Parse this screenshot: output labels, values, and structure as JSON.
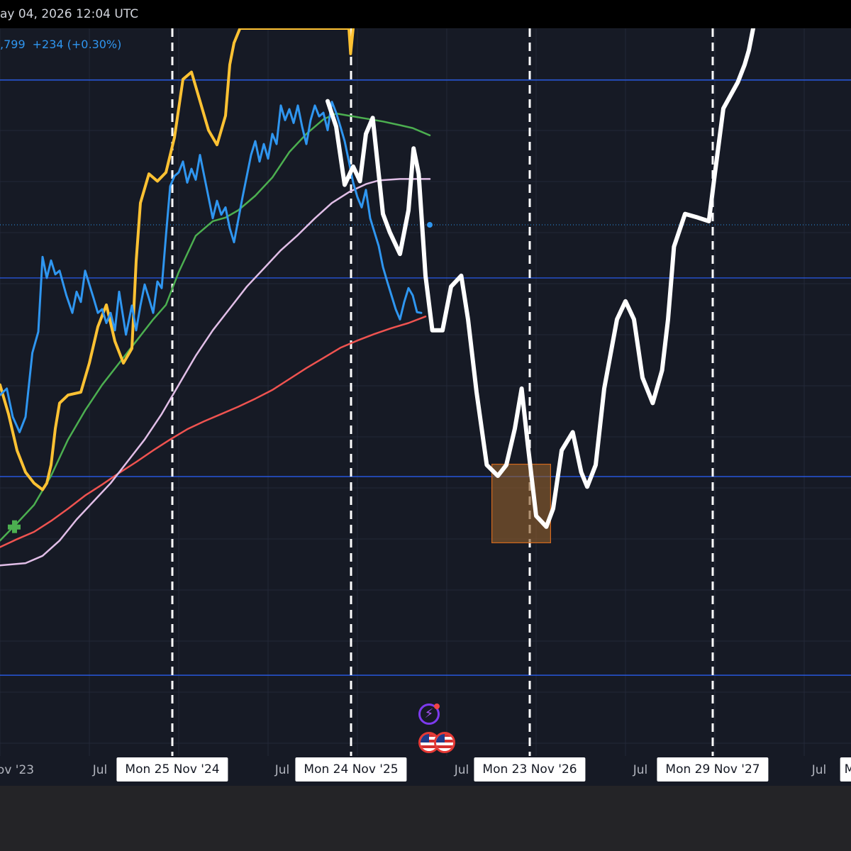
{
  "header": {
    "datetime": "ay 04, 2026 12:04 UTC",
    "price_fragment": ",799",
    "change": "+234 (+0.30%)"
  },
  "colors": {
    "background": "#161a25",
    "price_blue": "#2f96f0",
    "yellow": "#ffc233",
    "green": "#4caf50",
    "pink": "#e1bee7",
    "red": "#ef5350",
    "projection": "#ffffff",
    "box": "#8b5a2b",
    "hline": "#2962ff"
  },
  "axis": {
    "ticks": [
      "ov '23",
      "Jul",
      "Jul",
      "Jul",
      "Jul",
      "Jul",
      "M"
    ],
    "cycle_labels": [
      "Mon 25 Nov '24",
      "Mon 24 Nov '25",
      "Mon 23 Nov '26",
      "Mon 29 Nov '27"
    ]
  },
  "icons": [
    "flag-icon",
    "flag-icon",
    "spark-icon"
  ],
  "chart_data": {
    "type": "line",
    "x_range": [
      0,
      100
    ],
    "y_range": [
      0,
      100
    ],
    "grid": true,
    "horizontal_levels": [
      92.9,
      65.7,
      38.4,
      11.1
    ],
    "current_price_level": 73.0,
    "cycle_markers_x": [
      20.25,
      41.25,
      62.25,
      83.75
    ],
    "highlight_box": {
      "x0": 57.8,
      "x1": 64.7,
      "y0": 29.3,
      "y1": 40.1
    },
    "series": [
      {
        "id": "price",
        "points": [
          [
            0,
            49.6
          ],
          [
            0.8,
            50.5
          ],
          [
            1.5,
            46.6
          ],
          [
            2.3,
            44.5
          ],
          [
            3.0,
            46.6
          ],
          [
            3.8,
            55.4
          ],
          [
            4.5,
            58.3
          ],
          [
            5.0,
            68.6
          ],
          [
            5.5,
            65.7
          ],
          [
            6.0,
            68.1
          ],
          [
            6.5,
            66.2
          ],
          [
            7.0,
            66.7
          ],
          [
            7.8,
            63.3
          ],
          [
            8.5,
            60.9
          ],
          [
            9.0,
            63.8
          ],
          [
            9.5,
            62.4
          ],
          [
            10.0,
            66.7
          ],
          [
            10.5,
            64.8
          ],
          [
            11.0,
            62.9
          ],
          [
            11.5,
            60.9
          ],
          [
            12.0,
            61.4
          ],
          [
            12.5,
            59.5
          ],
          [
            13.0,
            60.9
          ],
          [
            13.5,
            58.5
          ],
          [
            14.0,
            63.8
          ],
          [
            14.8,
            57.9
          ],
          [
            15.5,
            61.9
          ],
          [
            16.0,
            58.5
          ],
          [
            16.5,
            61.9
          ],
          [
            17.0,
            64.8
          ],
          [
            17.5,
            62.9
          ],
          [
            18.0,
            60.9
          ],
          [
            18.5,
            65.2
          ],
          [
            19.0,
            64.3
          ],
          [
            19.5,
            71.5
          ],
          [
            20.0,
            78.3
          ],
          [
            20.5,
            79.7
          ],
          [
            21.0,
            80.2
          ],
          [
            21.5,
            81.7
          ],
          [
            22.0,
            78.8
          ],
          [
            22.5,
            80.7
          ],
          [
            23.0,
            79.2
          ],
          [
            23.5,
            82.6
          ],
          [
            24.0,
            79.7
          ],
          [
            24.5,
            76.8
          ],
          [
            25.0,
            73.9
          ],
          [
            25.5,
            76.3
          ],
          [
            26.0,
            74.4
          ],
          [
            26.5,
            75.4
          ],
          [
            27.0,
            72.5
          ],
          [
            27.5,
            70.6
          ],
          [
            28.5,
            76.8
          ],
          [
            29.0,
            79.7
          ],
          [
            29.5,
            82.6
          ],
          [
            30.0,
            84.5
          ],
          [
            30.5,
            81.7
          ],
          [
            31.0,
            84.1
          ],
          [
            31.5,
            82.1
          ],
          [
            32.0,
            85.5
          ],
          [
            32.5,
            84.1
          ],
          [
            33.0,
            89.4
          ],
          [
            33.5,
            87.4
          ],
          [
            34.0,
            88.9
          ],
          [
            34.5,
            87.0
          ],
          [
            35.0,
            89.4
          ],
          [
            35.5,
            86.5
          ],
          [
            36.0,
            84.1
          ],
          [
            36.5,
            87.4
          ],
          [
            37.0,
            89.4
          ],
          [
            37.5,
            87.9
          ],
          [
            38.0,
            88.4
          ],
          [
            38.5,
            86.0
          ],
          [
            39.0,
            89.9
          ],
          [
            39.5,
            88.4
          ],
          [
            40.0,
            86.5
          ],
          [
            40.5,
            84.5
          ],
          [
            41.0,
            81.7
          ],
          [
            41.5,
            78.8
          ],
          [
            42.0,
            76.8
          ],
          [
            42.5,
            75.4
          ],
          [
            43.0,
            77.8
          ],
          [
            43.5,
            73.9
          ],
          [
            44.0,
            72.0
          ],
          [
            44.5,
            70.1
          ],
          [
            45.0,
            67.2
          ],
          [
            45.5,
            65.2
          ],
          [
            46.0,
            63.3
          ],
          [
            46.5,
            61.4
          ],
          [
            47.0,
            60.0
          ],
          [
            47.5,
            62.4
          ],
          [
            48.0,
            64.3
          ],
          [
            48.5,
            63.3
          ],
          [
            49.0,
            61.0
          ],
          [
            49.5,
            60.9
          ]
        ]
      },
      {
        "id": "yellow_oscillator",
        "points": [
          [
            0,
            51.0
          ],
          [
            1,
            47.0
          ],
          [
            2,
            42.0
          ],
          [
            3,
            39.0
          ],
          [
            4,
            37.5
          ],
          [
            5,
            36.6
          ],
          [
            5.5,
            37.5
          ],
          [
            6.0,
            40.0
          ],
          [
            6.5,
            45.0
          ],
          [
            7.0,
            48.5
          ],
          [
            8.0,
            49.6
          ],
          [
            9.5,
            50.0
          ],
          [
            10.5,
            54.0
          ],
          [
            11.5,
            59.0
          ],
          [
            12.5,
            62.0
          ],
          [
            13.5,
            57.0
          ],
          [
            14.5,
            54.0
          ],
          [
            15.5,
            56.0
          ],
          [
            16.0,
            68.0
          ],
          [
            16.5,
            76.0
          ],
          [
            17.5,
            80.0
          ],
          [
            18.5,
            79.0
          ],
          [
            19.5,
            80.2
          ],
          [
            20.5,
            85.0
          ],
          [
            21.5,
            93.0
          ],
          [
            22.5,
            94.0
          ],
          [
            23.5,
            90.0
          ],
          [
            24.5,
            86.0
          ],
          [
            25.5,
            84.0
          ],
          [
            26.5,
            88.0
          ],
          [
            27.0,
            95.0
          ],
          [
            27.5,
            98.0
          ],
          [
            28.2,
            100.0
          ],
          [
            41.0,
            100.0
          ],
          [
            41.2,
            96.5
          ],
          [
            41.5,
            100.0
          ]
        ]
      },
      {
        "id": "green_ma",
        "points": [
          [
            0,
            29.6
          ],
          [
            2,
            32.0
          ],
          [
            4,
            34.5
          ],
          [
            6,
            38.5
          ],
          [
            8,
            43.5
          ],
          [
            10,
            47.5
          ],
          [
            12,
            51.0
          ],
          [
            14,
            54.0
          ],
          [
            16,
            57.0
          ],
          [
            18,
            60.0
          ],
          [
            19.5,
            62.0
          ],
          [
            21,
            66.5
          ],
          [
            23,
            71.5
          ],
          [
            25,
            73.5
          ],
          [
            26.5,
            74.0
          ],
          [
            28,
            75.0
          ],
          [
            30,
            77.0
          ],
          [
            32,
            79.5
          ],
          [
            34,
            83.0
          ],
          [
            36,
            85.5
          ],
          [
            38,
            87.5
          ],
          [
            39.5,
            88.3
          ],
          [
            41,
            88.0
          ],
          [
            43,
            87.6
          ],
          [
            45,
            87.2
          ],
          [
            47,
            86.7
          ],
          [
            48.5,
            86.3
          ],
          [
            50.5,
            85.3
          ]
        ]
      },
      {
        "id": "pink_ma",
        "points": [
          [
            0,
            26.2
          ],
          [
            3,
            26.5
          ],
          [
            5,
            27.5
          ],
          [
            7,
            29.6
          ],
          [
            9,
            32.5
          ],
          [
            11,
            35.0
          ],
          [
            13,
            37.5
          ],
          [
            15,
            40.5
          ],
          [
            17,
            43.5
          ],
          [
            19,
            47.0
          ],
          [
            21,
            51.0
          ],
          [
            23,
            55.0
          ],
          [
            25,
            58.5
          ],
          [
            27,
            61.5
          ],
          [
            29,
            64.5
          ],
          [
            31,
            67.0
          ],
          [
            33,
            69.5
          ],
          [
            35,
            71.6
          ],
          [
            37,
            73.9
          ],
          [
            39,
            76.0
          ],
          [
            41,
            77.5
          ],
          [
            43,
            78.6
          ],
          [
            44.5,
            79.1
          ],
          [
            47,
            79.3
          ],
          [
            50.5,
            79.3
          ]
        ]
      },
      {
        "id": "red_ma",
        "points": [
          [
            0,
            28.7
          ],
          [
            2,
            29.8
          ],
          [
            4,
            30.8
          ],
          [
            6,
            32.3
          ],
          [
            8,
            34.0
          ],
          [
            10,
            35.8
          ],
          [
            12,
            37.3
          ],
          [
            14,
            38.9
          ],
          [
            16,
            40.4
          ],
          [
            18,
            42.0
          ],
          [
            20,
            43.5
          ],
          [
            22,
            44.9
          ],
          [
            24,
            46.0
          ],
          [
            26,
            47.0
          ],
          [
            28,
            48.0
          ],
          [
            30,
            49.1
          ],
          [
            32,
            50.3
          ],
          [
            34,
            51.8
          ],
          [
            36,
            53.3
          ],
          [
            38,
            54.7
          ],
          [
            40,
            56.1
          ],
          [
            42,
            57.1
          ],
          [
            44,
            58.0
          ],
          [
            46,
            58.8
          ],
          [
            48,
            59.5
          ],
          [
            50,
            60.4
          ]
        ]
      },
      {
        "id": "projection",
        "points": [
          [
            38.5,
            90.0
          ],
          [
            39.5,
            86.5
          ],
          [
            40.5,
            78.5
          ],
          [
            41.5,
            81.0
          ],
          [
            42.3,
            79.0
          ],
          [
            43.0,
            85.5
          ],
          [
            43.8,
            87.7
          ],
          [
            44.5,
            80.0
          ],
          [
            45.0,
            74.5
          ],
          [
            45.8,
            72.0
          ],
          [
            47.0,
            69.0
          ],
          [
            48.0,
            75.0
          ],
          [
            48.6,
            83.5
          ],
          [
            49.2,
            80.0
          ],
          [
            50.0,
            66.0
          ],
          [
            50.8,
            58.5
          ],
          [
            52.0,
            58.5
          ],
          [
            53.0,
            64.5
          ],
          [
            54.2,
            66.0
          ],
          [
            55.0,
            60.0
          ],
          [
            56.0,
            50.0
          ],
          [
            57.2,
            40.0
          ],
          [
            58.5,
            38.5
          ],
          [
            59.5,
            40.0
          ],
          [
            60.5,
            45.0
          ],
          [
            61.3,
            50.5
          ],
          [
            62.0,
            43.0
          ],
          [
            63.0,
            33.0
          ],
          [
            64.2,
            31.5
          ],
          [
            65.0,
            34.0
          ],
          [
            66.0,
            42.0
          ],
          [
            67.3,
            44.5
          ],
          [
            68.3,
            39.0
          ],
          [
            69.0,
            37.0
          ],
          [
            70.0,
            40.0
          ],
          [
            71.0,
            50.5
          ],
          [
            72.5,
            60.0
          ],
          [
            73.5,
            62.5
          ],
          [
            74.5,
            60.0
          ],
          [
            75.5,
            52.0
          ],
          [
            76.7,
            48.5
          ],
          [
            77.8,
            53.0
          ],
          [
            78.5,
            60.0
          ],
          [
            79.2,
            70.0
          ],
          [
            80.5,
            74.5
          ],
          [
            82.0,
            74.0
          ],
          [
            83.3,
            73.5
          ],
          [
            84.0,
            80.0
          ],
          [
            85.0,
            89.0
          ],
          [
            86.7,
            92.6
          ],
          [
            87.5,
            95.0
          ],
          [
            88.0,
            97.0
          ],
          [
            88.5,
            100.0
          ]
        ]
      }
    ]
  }
}
